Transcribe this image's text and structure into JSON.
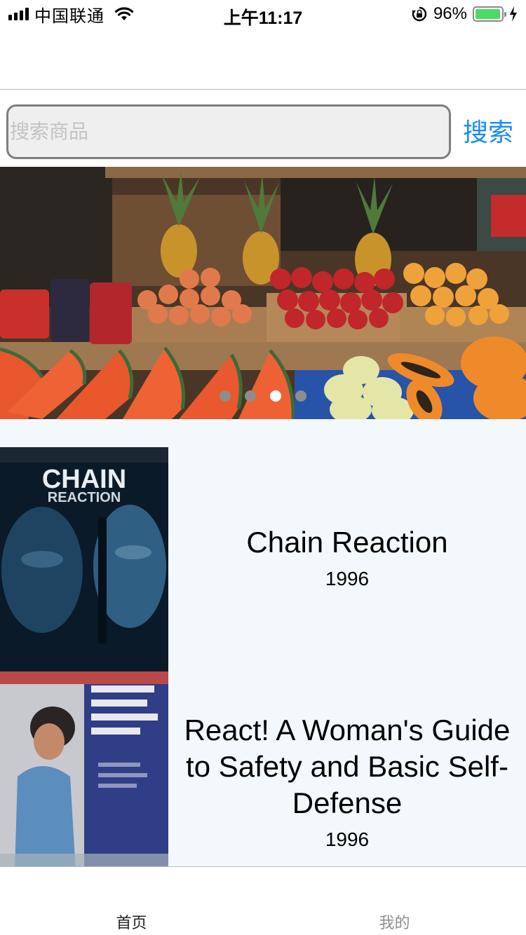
{
  "status_bar": {
    "carrier": "中国联通",
    "time": "上午11:17",
    "battery_percent": "96%",
    "battery_level": 0.96,
    "icons": [
      "signal-icon",
      "wifi-icon",
      "rotation-lock-icon",
      "battery-icon",
      "charging-icon"
    ]
  },
  "search": {
    "placeholder": "搜索商品",
    "value": "",
    "button_label": "搜索"
  },
  "banner": {
    "slide_count": 4,
    "active_index": 2
  },
  "movies": [
    {
      "title": "Chain Reaction",
      "year": "1996",
      "poster_text": "CHAIN REACTION"
    },
    {
      "title": "React! A Woman's Guide to Safety and Basic Self-Defense",
      "year": "1996"
    }
  ],
  "tabs": [
    {
      "label": "首页",
      "active": true
    },
    {
      "label": "我的",
      "active": false
    }
  ],
  "colors": {
    "accent": "#1a8cf4",
    "list_background": "#f3f8fc",
    "battery_green": "#4cd964"
  }
}
